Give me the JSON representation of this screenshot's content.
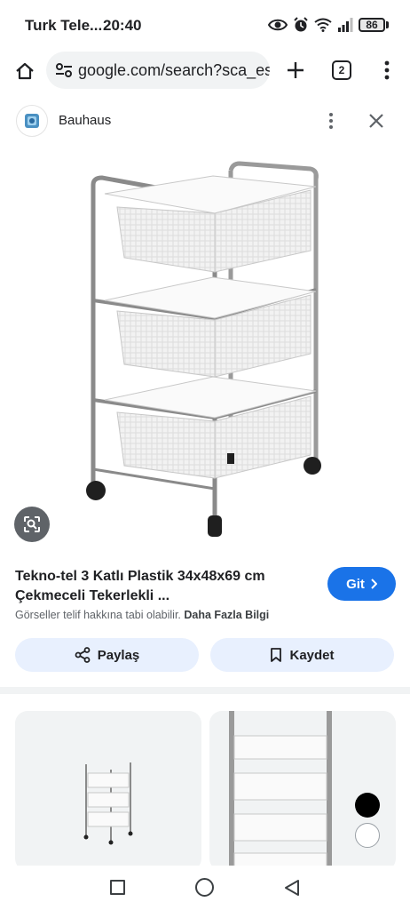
{
  "status_bar": {
    "carrier": "Turk Tele...",
    "time": "20:40",
    "battery": "86",
    "icons": [
      "eye-icon",
      "alarm-icon",
      "wifi-icon",
      "signal-icon",
      "battery-icon"
    ]
  },
  "browser": {
    "url": "google.com/search?sca_esv",
    "tab_count": "2"
  },
  "panel": {
    "source_name": "Bauhaus",
    "product_title": "Tekno-tel 3 Katlı Plastik 34x48x69 cm Çekmeceli Tekerlekli ...",
    "go_label": "Git",
    "copyright_text": "Görseller telif hakkına tabi olabilir.",
    "more_info_label": "Daha Fazla Bilgi",
    "share_label": "Paylaş",
    "save_label": "Kaydet"
  },
  "colors": {
    "accent": "#1a73e8",
    "action_button_bg": "#e8f0fe",
    "lens_button_bg": "#5f6368"
  }
}
